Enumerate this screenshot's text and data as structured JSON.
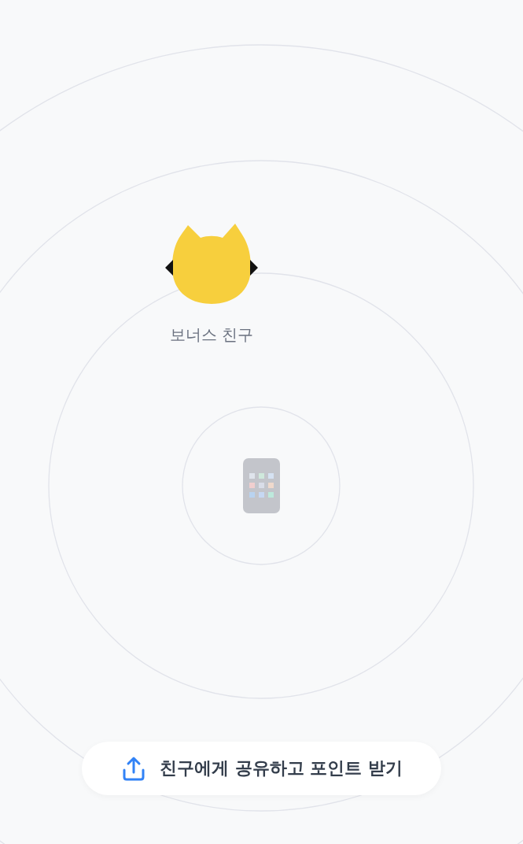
{
  "friends": [
    {
      "name": "보너스 친구"
    }
  ],
  "share_button": {
    "label": "친구에게 공유하고 포인트 받기"
  }
}
